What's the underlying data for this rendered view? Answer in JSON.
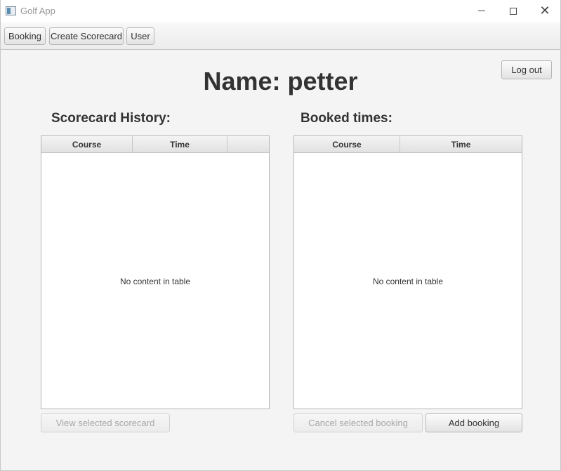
{
  "window": {
    "title": "Golf App",
    "close_glyph": "✕"
  },
  "navbar": {
    "booking_label": "Booking",
    "create_scorecard_label": "Create Scorecard",
    "user_label": "User"
  },
  "header": {
    "logout_label": "Log out",
    "title": "Name: petter"
  },
  "scorecard_history": {
    "title": "Scorecard History:",
    "columns": [
      "Course",
      "Time",
      ""
    ],
    "rows": [],
    "empty_message": "No content in table",
    "view_button_label": "View selected scorecard",
    "view_button_enabled": false
  },
  "booked_times": {
    "title": "Booked times:",
    "columns": [
      "Course",
      "Time"
    ],
    "rows": [],
    "empty_message": "No content in table",
    "cancel_button_label": "Cancel selected booking",
    "cancel_button_enabled": false,
    "add_button_label": "Add booking"
  },
  "icons": {
    "app": "app-window-icon",
    "minimize": "minimize-icon",
    "maximize": "maximize-icon",
    "close": "close-icon"
  }
}
